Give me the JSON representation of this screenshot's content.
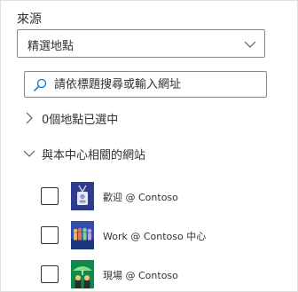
{
  "source": {
    "label": "來源",
    "dropdown": {
      "selected": "精選地點",
      "icon": "chevron-down-icon"
    }
  },
  "search": {
    "placeholder": "請依標題搜尋或輸入網址",
    "value": "",
    "icon": "search-icon"
  },
  "groups": [
    {
      "label": "0個地點已選中",
      "expanded": false,
      "icon": "chevron-right-icon"
    },
    {
      "label": "與本中心相關的網站",
      "expanded": true,
      "icon": "chevron-down-icon"
    }
  ],
  "sites": [
    {
      "name": "歡迎 @ Contoso",
      "checked": false,
      "thumb_color": "#2e3c8f"
    },
    {
      "name": "Work @ Contoso 中心",
      "checked": false,
      "thumb_color": "#2f4eab"
    },
    {
      "name": "現場 @ Contoso",
      "checked": false,
      "thumb_color": "#0f8a4a"
    }
  ],
  "colors": {
    "accent": "#0078d4",
    "border": "#8a8886",
    "text": "#323130"
  }
}
